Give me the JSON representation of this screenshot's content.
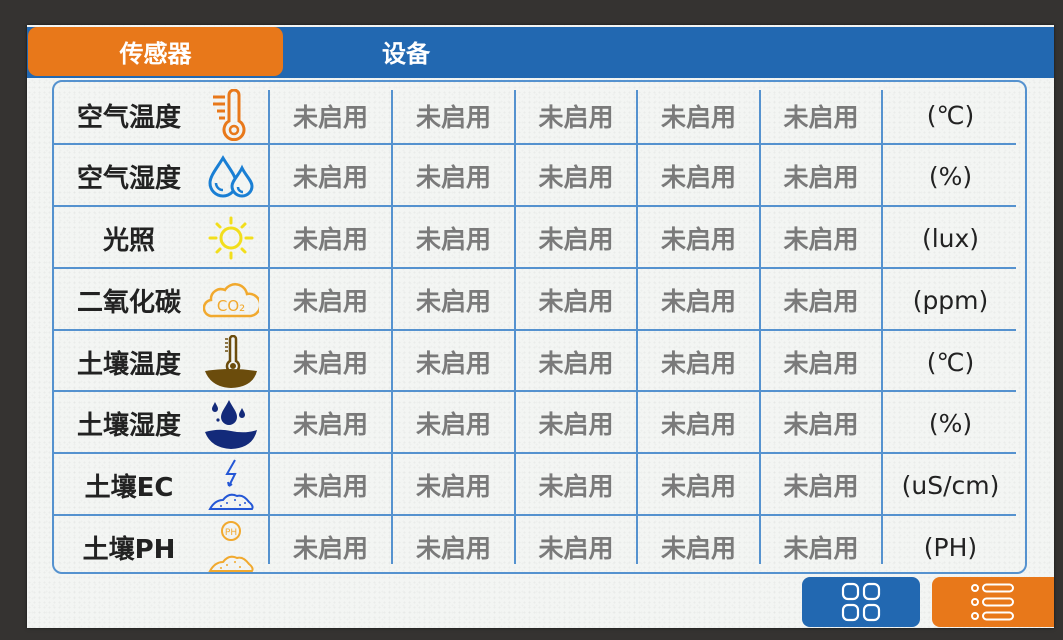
{
  "tabs": [
    {
      "label": "传感器",
      "active": true
    },
    {
      "label": "设备",
      "active": false
    }
  ],
  "status_columns": 5,
  "rows": [
    {
      "label": "空气温度",
      "icon": "thermometer-icon",
      "icon_color": "#e8781a",
      "status": [
        "未启用",
        "未启用",
        "未启用",
        "未启用",
        "未启用"
      ],
      "unit": "(℃)"
    },
    {
      "label": "空气湿度",
      "icon": "humidity-drops-icon",
      "icon_color": "#1a7fd4",
      "status": [
        "未启用",
        "未启用",
        "未启用",
        "未启用",
        "未启用"
      ],
      "unit": "(%)"
    },
    {
      "label": "光照",
      "icon": "sun-icon",
      "icon_color": "#f2de1c",
      "status": [
        "未启用",
        "未启用",
        "未启用",
        "未启用",
        "未启用"
      ],
      "unit": "(lux)"
    },
    {
      "label": "二氧化碳",
      "icon": "co2-cloud-icon",
      "icon_color": "#f1a92e",
      "icon_text": "CO₂",
      "status": [
        "未启用",
        "未启用",
        "未启用",
        "未启用",
        "未启用"
      ],
      "unit": "(ppm)"
    },
    {
      "label": "土壤温度",
      "icon": "soil-thermometer-icon",
      "icon_color": "#6b4c0c",
      "status": [
        "未启用",
        "未启用",
        "未启用",
        "未启用",
        "未启用"
      ],
      "unit": "(℃)"
    },
    {
      "label": "土壤湿度",
      "icon": "soil-moisture-icon",
      "icon_color": "#132a7a",
      "status": [
        "未启用",
        "未启用",
        "未启用",
        "未启用",
        "未启用"
      ],
      "unit": "(%)"
    },
    {
      "label": "土壤EC",
      "icon": "soil-ec-icon",
      "icon_color": "#2457d6",
      "status": [
        "未启用",
        "未启用",
        "未启用",
        "未启用",
        "未启用"
      ],
      "unit": "(uS/cm)"
    },
    {
      "label": "土壤PH",
      "icon": "soil-ph-icon",
      "icon_color": "#f1a92e",
      "icon_text": "PH",
      "status": [
        "未启用",
        "未启用",
        "未启用",
        "未启用",
        "未启用"
      ],
      "unit": "(PH)"
    }
  ],
  "buttons": {
    "grid": {
      "icon": "grid-view-icon",
      "color": "#2268b1"
    },
    "list": {
      "icon": "list-view-icon",
      "color": "#e8781a"
    }
  },
  "colors": {
    "accent_orange": "#e8781a",
    "accent_blue": "#2268b1",
    "grid_line": "#5592cf",
    "status_text": "#7a7a7a"
  }
}
